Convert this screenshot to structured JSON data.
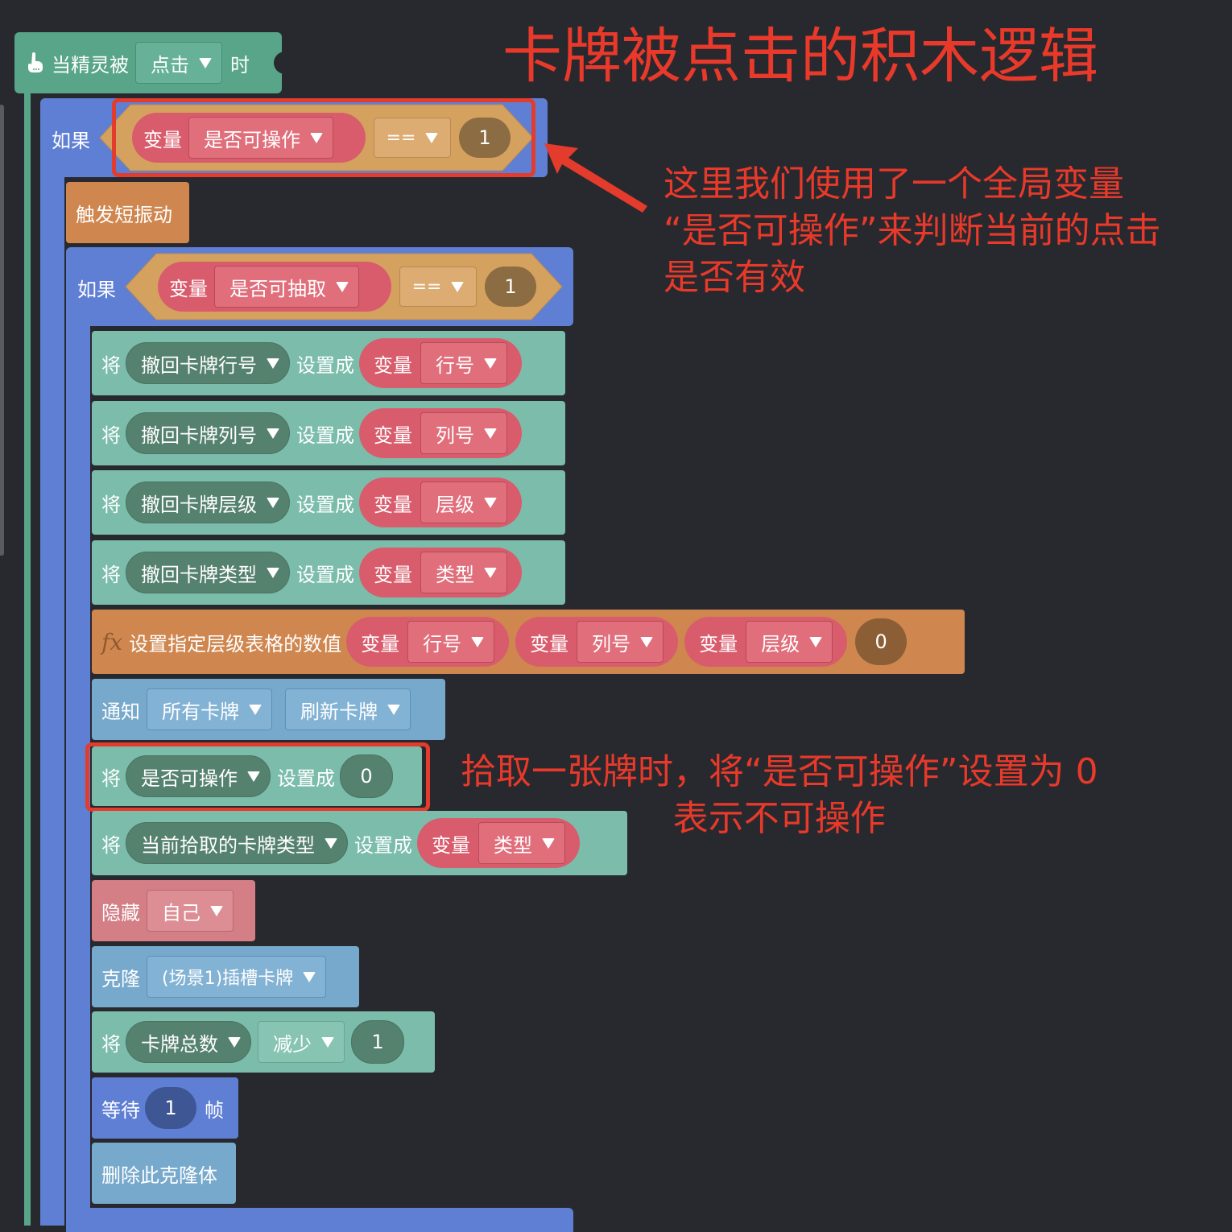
{
  "title": "卡牌被点击的积木逻辑",
  "annotations": {
    "top": [
      "这里我们使用了一个全局变量",
      "“是否可操作”来判断当前的点击",
      "是否有效"
    ],
    "middle": [
      "拾取一张牌时，将“是否可操作”设置为 0",
      "表示不可操作"
    ]
  },
  "event": {
    "prefix": "当精灵被",
    "dropdown": "点击",
    "suffix": "时",
    "icon": "hand-pointer-icon"
  },
  "if1": {
    "label": "如果",
    "var_label": "变量",
    "var_name": "是否可操作",
    "op": "==",
    "value": "1"
  },
  "haptic": {
    "label": "触发短振动"
  },
  "if2": {
    "label": "如果",
    "var_label": "变量",
    "var_name": "是否可抽取",
    "op": "==",
    "value": "1"
  },
  "set_rows": [
    {
      "set": "将",
      "target": "撤回卡牌行号",
      "to": "设置成",
      "var_label": "变量",
      "var": "行号"
    },
    {
      "set": "将",
      "target": "撤回卡牌列号",
      "to": "设置成",
      "var_label": "变量",
      "var": "列号"
    },
    {
      "set": "将",
      "target": "撤回卡牌层级",
      "to": "设置成",
      "var_label": "变量",
      "var": "层级"
    },
    {
      "set": "将",
      "target": "撤回卡牌类型",
      "to": "设置成",
      "var_label": "变量",
      "var": "类型"
    }
  ],
  "func": {
    "icon": "fx",
    "label": "设置指定层级表格的数值",
    "args": [
      {
        "var_label": "变量",
        "var": "行号"
      },
      {
        "var_label": "变量",
        "var": "列号"
      },
      {
        "var_label": "变量",
        "var": "层级"
      }
    ],
    "value": "0"
  },
  "notify": {
    "label": "通知",
    "target": "所有卡牌",
    "message": "刷新卡牌"
  },
  "set_operable": {
    "set": "将",
    "target": "是否可操作",
    "to": "设置成",
    "value": "0"
  },
  "set_picked": {
    "set": "将",
    "target": "当前拾取的卡牌类型",
    "to": "设置成",
    "var_label": "变量",
    "var": "类型"
  },
  "hide": {
    "label": "隐藏",
    "target": "自己"
  },
  "clone": {
    "label": "克隆",
    "target": "(场景1)插槽卡牌"
  },
  "change": {
    "set": "将",
    "target": "卡牌总数",
    "op": "减少",
    "value": "1"
  },
  "wait": {
    "label": "等待",
    "value": "1",
    "unit": "帧"
  },
  "delete_clone": {
    "label": "删除此克隆体"
  }
}
